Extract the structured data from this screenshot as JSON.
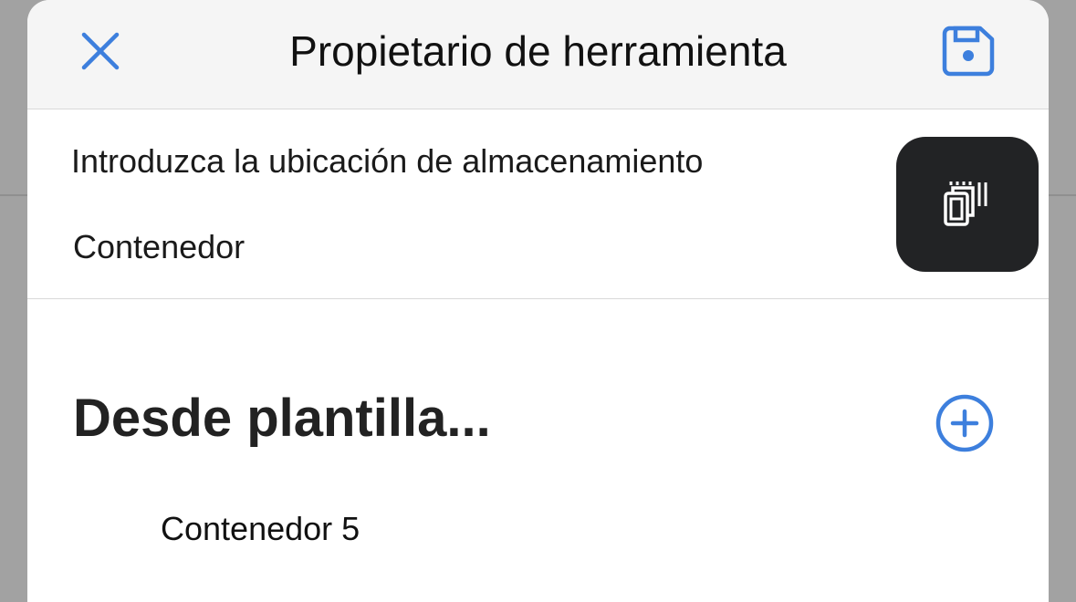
{
  "header": {
    "title": "Propietario de herramienta",
    "close_icon": "close-icon",
    "save_icon": "save-icon"
  },
  "location": {
    "label": "Introduzca la ubicación de almacenamiento",
    "value": "Contenedor"
  },
  "templates": {
    "title": "Desde plantilla...",
    "add_icon": "add-circle-icon",
    "items": [
      {
        "label": "Contenedor 5"
      }
    ]
  },
  "scan_button": {
    "icon": "scan-device-icon"
  },
  "colors": {
    "accent": "#3d7fdd",
    "header_bg": "#f5f5f5",
    "scan_bg": "#222325"
  }
}
